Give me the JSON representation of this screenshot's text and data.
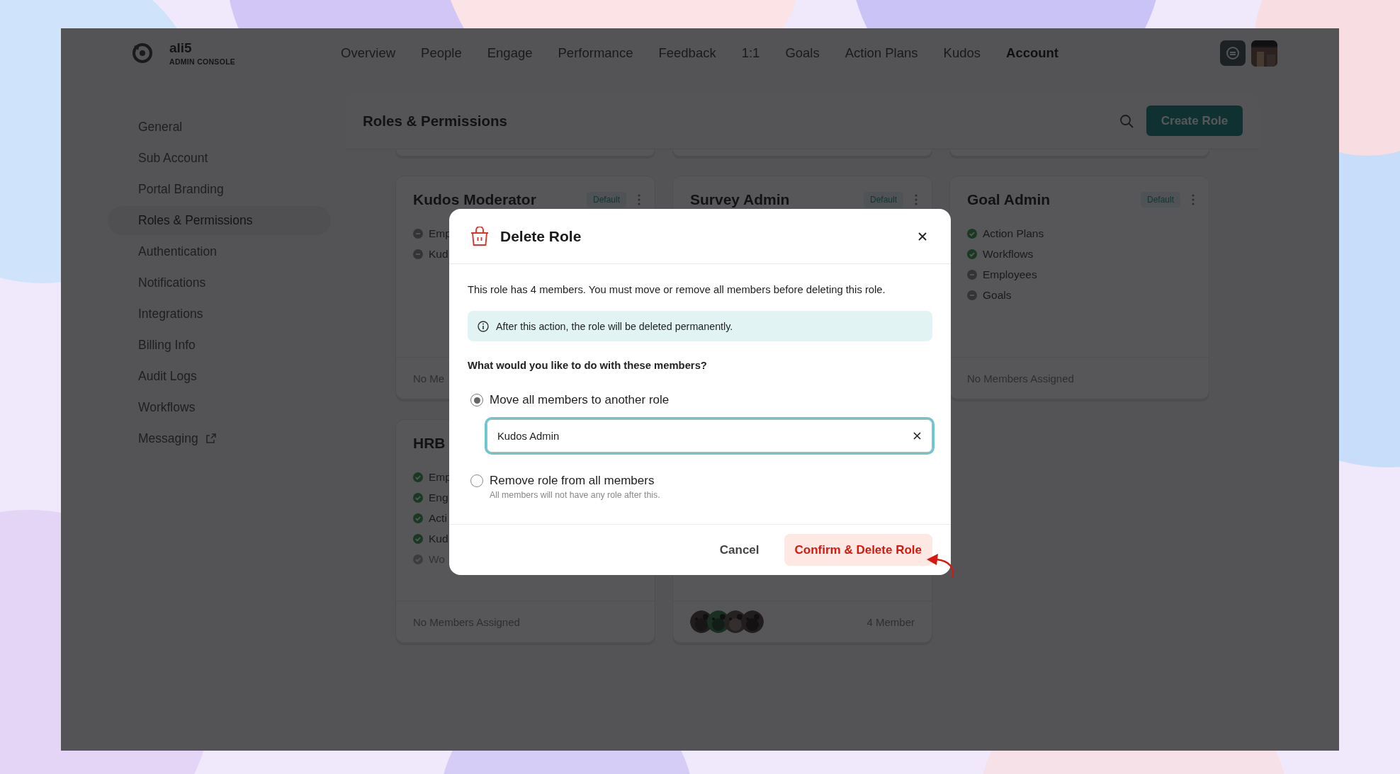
{
  "header": {
    "brand": "ali5",
    "subtitle": "ADMIN CONSOLE",
    "nav": [
      {
        "label": "Overview",
        "selected": false
      },
      {
        "label": "People",
        "selected": false
      },
      {
        "label": "Engage",
        "selected": false
      },
      {
        "label": "Performance",
        "selected": false
      },
      {
        "label": "Feedback",
        "selected": false
      },
      {
        "label": "1:1",
        "selected": false
      },
      {
        "label": "Goals",
        "selected": false
      },
      {
        "label": "Action Plans",
        "selected": false
      },
      {
        "label": "Kudos",
        "selected": false
      },
      {
        "label": "Account",
        "selected": true
      }
    ]
  },
  "sidebar": {
    "items": [
      {
        "label": "General",
        "selected": false,
        "external": false
      },
      {
        "label": "Sub Account",
        "selected": false,
        "external": false
      },
      {
        "label": "Portal Branding",
        "selected": false,
        "external": false
      },
      {
        "label": "Roles & Permissions",
        "selected": true,
        "external": false
      },
      {
        "label": "Authentication",
        "selected": false,
        "external": false
      },
      {
        "label": "Notifications",
        "selected": false,
        "external": false
      },
      {
        "label": "Integrations",
        "selected": false,
        "external": false
      },
      {
        "label": "Billing Info",
        "selected": false,
        "external": false
      },
      {
        "label": "Audit Logs",
        "selected": false,
        "external": false
      },
      {
        "label": "Workflows",
        "selected": false,
        "external": false
      },
      {
        "label": "Messaging",
        "selected": false,
        "external": true
      }
    ]
  },
  "panel": {
    "title": "Roles & Permissions",
    "create_button": "Create Role",
    "cards": [
      {
        "title": "Kudos Moderator",
        "badge": "Default",
        "permissions": [
          {
            "label": "Emp",
            "granted": false,
            "muted": false
          },
          {
            "label": "Kud",
            "granted": false,
            "muted": false
          }
        ],
        "footer": "No Me"
      },
      {
        "title": "Survey Admin",
        "badge": "Default"
      },
      {
        "title": "Goal Admin",
        "badge": "Default",
        "permissions": [
          {
            "label": "Action Plans",
            "granted": true,
            "muted": false
          },
          {
            "label": "Workflows",
            "granted": true,
            "muted": false
          },
          {
            "label": "Employees",
            "granted": false,
            "muted": false
          },
          {
            "label": "Goals",
            "granted": false,
            "muted": false
          }
        ],
        "footer": "No Members Assigned"
      },
      {
        "title": "HRB",
        "permissions": [
          {
            "label": "Emp",
            "granted": true,
            "muted": false
          },
          {
            "label": "Eng",
            "granted": true,
            "muted": false
          },
          {
            "label": "Acti",
            "granted": true,
            "muted": false
          },
          {
            "label": "Kud",
            "granted": true,
            "muted": false
          },
          {
            "label": "Wo",
            "granted": true,
            "muted": true
          }
        ],
        "footer": "No Members Assigned"
      },
      {
        "footer": "4 Member"
      }
    ]
  },
  "modal": {
    "title": "Delete Role",
    "message": "This role has 4 members. You must move or remove all members before deleting this role.",
    "notice": "After this action, the role will be deleted permanently.",
    "question": "What would you like to do with these members?",
    "options": [
      {
        "label": "Move all members to another role",
        "selected": true,
        "field": {
          "value": "Kudos Admin"
        }
      },
      {
        "label": "Remove role from all members",
        "selected": false,
        "hint": "All members will not have any role after this."
      }
    ],
    "buttons": [
      {
        "label": "Cancel",
        "kind": "secondary"
      },
      {
        "label": "Confirm & Delete Role",
        "kind": "danger"
      }
    ]
  }
}
